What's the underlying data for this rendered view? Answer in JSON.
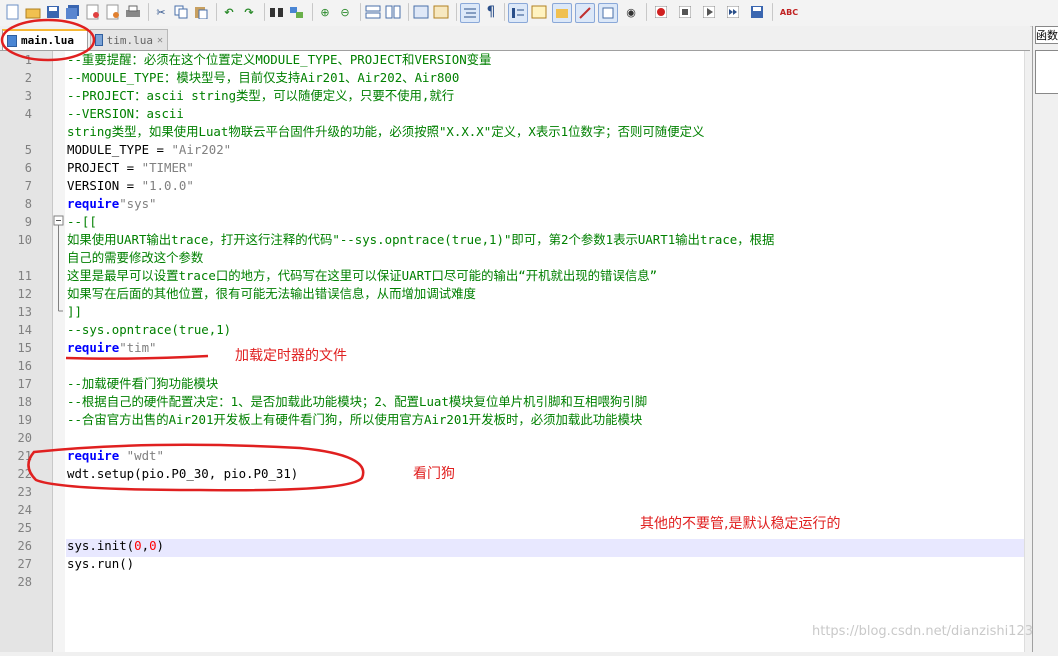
{
  "toolbar": {
    "icons": [
      "new-file-icon",
      "open-file-icon",
      "save-icon",
      "save-all-icon",
      "close-icon",
      "close-all-icon",
      "print-icon",
      "cut-icon",
      "copy-icon",
      "paste-icon",
      "undo-icon",
      "redo-icon",
      "find-icon",
      "replace-icon",
      "zoom-in-icon",
      "zoom-out-icon",
      "sync-vertical-icon",
      "sync-horizontal-icon",
      "word-wrap-icon",
      "show-all-chars-icon",
      "indent-guide-icon",
      "doc-map-icon",
      "function-list-icon",
      "folder-workspace-icon",
      "eye-monitor-icon",
      "record-macro-icon",
      "stop-record-icon",
      "play-macro-icon",
      "run-multiple-icon",
      "save-macro-icon",
      "spell-check-icon"
    ],
    "spellcheck_label": "ABC"
  },
  "tabs": [
    {
      "label": "main.lua",
      "active": true
    },
    {
      "label": "tim.lua",
      "active": false
    }
  ],
  "right_panel": {
    "label": "函数"
  },
  "editor": {
    "line_numbers": [
      "1",
      "2",
      "3",
      "4",
      "",
      "5",
      "6",
      "7",
      "8",
      "9",
      "10",
      "",
      "11",
      "12",
      "13",
      "14",
      "15",
      "16",
      "17",
      "18",
      "19",
      "20",
      "21",
      "22",
      "23",
      "24",
      "25",
      "26",
      "27",
      "28"
    ],
    "lines": {
      "l1": "--重要提醒：必须在这个位置定义MODULE_TYPE、PROJECT和VERSION变量",
      "l2": "--MODULE_TYPE：模块型号，目前仅支持Air201、Air202、Air800",
      "l3": "--PROJECT：ascii string类型，可以随便定义，只要不使用,就行",
      "l4a": "--VERSION：ascii",
      "l4b": "string类型，如果使用Luat物联云平台固件升级的功能，必须按照\"X.X.X\"定义，X表示1位数字；否则可随便定义",
      "l5_id": "MODULE_TYPE = ",
      "l5_str": "\"Air202\"",
      "l6_id": "PROJECT = ",
      "l6_str": "\"TIMER\"",
      "l7_id": "VERSION = ",
      "l7_str": "\"1.0.0\"",
      "l8_kw": "require",
      "l8_str": "\"sys\"",
      "l9": "--[[",
      "l10a": "如果使用UART输出trace，打开这行注释的代码\"--sys.opntrace(true,1)\"即可，第2个参数1表示UART1输出trace，根据",
      "l10b": "自己的需要修改这个参数",
      "l11": "这里是最早可以设置trace口的地方，代码写在这里可以保证UART口尽可能的输出“开机就出现的错误信息”",
      "l12": "如果写在后面的其他位置，很有可能无法输出错误信息，从而增加调试难度",
      "l13": "]]",
      "l14": "--sys.opntrace(true,1)",
      "l15_kw": "require",
      "l15_str": "\"tim\"",
      "l17": "--加载硬件看门狗功能模块",
      "l18": "--根据自己的硬件配置决定：1、是否加载此功能模块；2、配置Luat模块复位单片机引脚和互相喂狗引脚",
      "l19": "--合宙官方出售的Air201开发板上有硬件看门狗，所以使用官方Air201开发板时，必须加载此功能模块",
      "l21_kw": "require",
      "l21_str": " \"wdt\"",
      "l22": "wdt.setup(pio.P0_30, pio.P0_31)",
      "l26_a": "sys.init(",
      "l26_n1": "0",
      "l26_c": ",",
      "l26_n2": "0",
      "l26_e": ")",
      "l27": "sys.run()"
    }
  },
  "annotations": {
    "tim": "加载定时器的文件",
    "wdt": "看门狗",
    "others": "其他的不要管,是默认稳定运行的"
  },
  "watermark": "https://blog.csdn.net/dianzishi123",
  "colors": {
    "comment": "#008000",
    "keyword": "#0000ff",
    "string": "#808080",
    "number": "#ff0000",
    "annotation": "#e02020"
  }
}
